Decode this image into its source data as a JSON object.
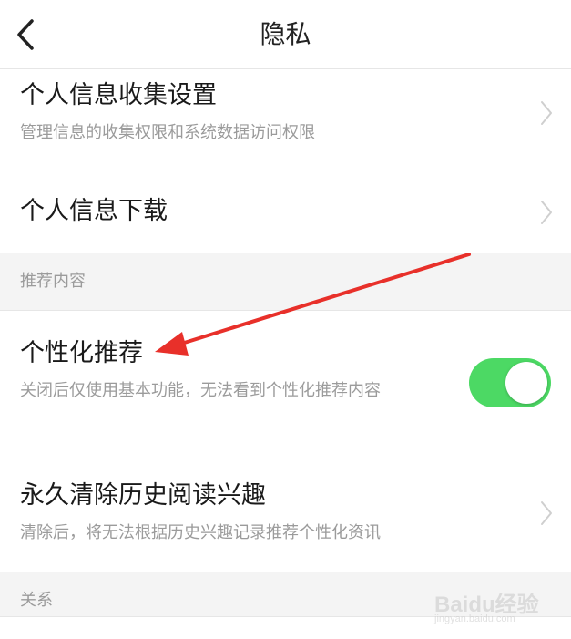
{
  "header": {
    "title": "隐私",
    "back_icon": "chevron-left-icon"
  },
  "items": [
    {
      "title": "个人信息收集设置",
      "subtitle": "管理信息的收集权限和系统数据访问权限",
      "icon": "chevron-right-icon"
    },
    {
      "title": "个人信息下载",
      "icon": "chevron-right-icon"
    }
  ],
  "sections": [
    {
      "label": "推荐内容"
    },
    {
      "label": "关系"
    }
  ],
  "recommend": {
    "personalized": {
      "title": "个性化推荐",
      "subtitle": "关闭后仅使用基本功能，无法看到个性化推荐内容",
      "toggle_on": true
    },
    "clear_history": {
      "title": "永久清除历史阅读兴趣",
      "subtitle": "清除后，将无法根据历史兴趣记录推荐个性化资讯",
      "icon": "chevron-right-icon"
    }
  },
  "colors": {
    "toggle_on": "#4cd964",
    "annotation_arrow": "#e8302a",
    "section_bg": "#f4f4f4"
  },
  "watermark": {
    "brand": "Baidu经验",
    "url": "jingyan.baidu.com"
  }
}
